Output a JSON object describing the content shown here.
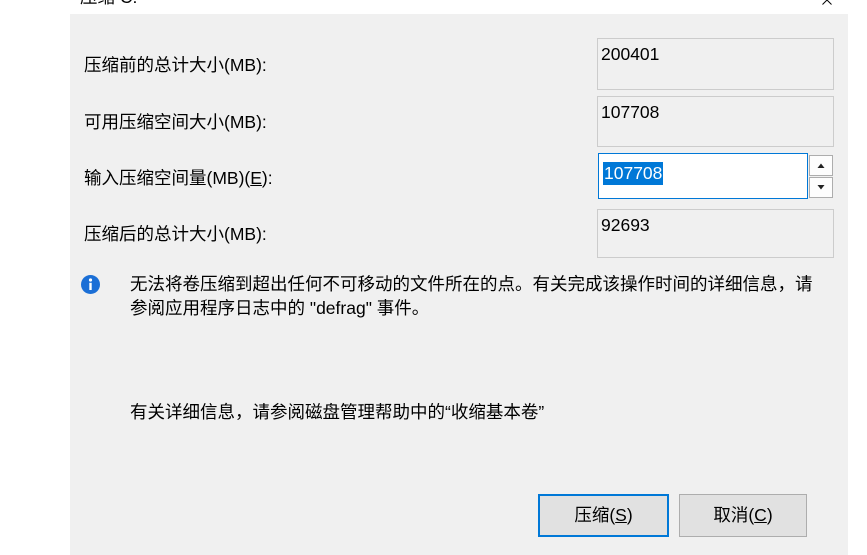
{
  "window": {
    "title": "压缩 C:",
    "close_icon": "close-icon"
  },
  "fields": {
    "total_before": {
      "label": "压缩前的总计大小(MB):",
      "value": 200401
    },
    "available": {
      "label": "可用压缩空间大小(MB):",
      "value": 107708
    },
    "shrink_amount": {
      "label": "输入压缩空间量(MB)(E):",
      "value": 107708,
      "spin_up_icon": "spin-up-icon",
      "spin_down_icon": "spin-down-icon"
    },
    "total_after": {
      "label": "压缩后的总计大小(MB):",
      "value": 92693
    }
  },
  "info_note": {
    "icon": "info-icon",
    "lines": [
      "无法将卷压缩到超出任何不可移动的文件所在的点。有关完成该操作时间的详细信息，请",
      "参阅应用程序日志中的 \"defrag\" 事件。"
    ]
  },
  "help_text": "有关详细信息，请参阅磁盘管理帮助中的“收缩基本卷”",
  "buttons": {
    "shrink": "压缩(S)",
    "cancel": "取消(C)"
  },
  "colors": {
    "accent": "#0078d7",
    "dialog_bg": "#f0f0f0",
    "info_icon": "#1b6fd6",
    "selection_text": "#ffffff"
  }
}
